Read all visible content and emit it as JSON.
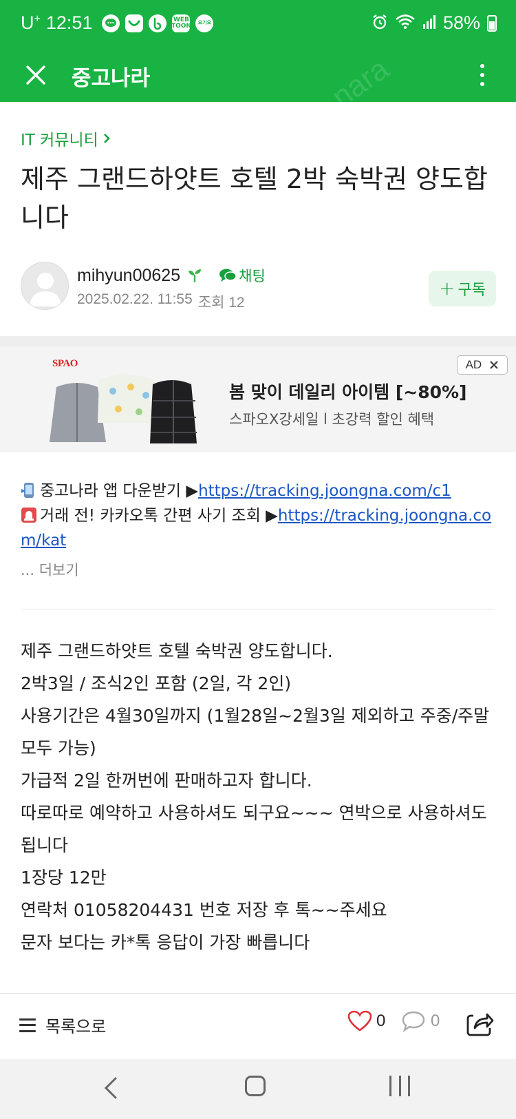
{
  "status_bar": {
    "carrier": "U",
    "carrier_sup": "+",
    "time": "12:51",
    "apps": [
      "chat-icon",
      "smile-app-icon",
      "b-app-icon",
      "webtoon-icon",
      "ohgiyo-icon"
    ],
    "webtoon_label": "WEB TOON",
    "ohgiyo_label": "요기요",
    "battery": "58%"
  },
  "app_bar": {
    "title": "중고나라",
    "watermark": "nara"
  },
  "article": {
    "breadcrumb": "IT 커뮤니티",
    "title": "제주 그랜드하얏트 호텔 2박 숙박권 양도합니다",
    "author": "mihyun00625",
    "chat_label": "채팅",
    "date": "2025.02.22. 11:55",
    "views": "조회 12",
    "subscribe_label": "구독"
  },
  "ad": {
    "brand": "SPAO",
    "badge": "AD",
    "title": "봄 맞이 데일리 아이템 [~80%]",
    "subtitle": "스파오X강세일 l 초강력 할인 혜택"
  },
  "links": {
    "line1_text": "중고나라 앱 다운받기 ▶",
    "line1_url": "https://tracking.joongna.com/c1",
    "line2_text": "거래 전! 카카오톡 간편 사기 조회 ▶",
    "line2_url": "https://tracking.joongna.com/kat",
    "more": "... 더보기"
  },
  "body_lines": [
    "제주 그랜드하얏트 호텔 숙박권 양도합니다.",
    "2박3일 / 조식2인 포함 (2일, 각 2인)",
    "사용기간은 4월30일까지 (1월28일~2월3일 제외하고 주중/주말 모두 가능)",
    "가급적 2일 한꺼번에 판매하고자 합니다.",
    "따로따로 예약하고 사용하셔도 되구요~~~ 연박으로 사용하셔도 됩니다",
    "1장당 12만",
    "연락처 01058204431 번호 저장 후 톡~~주세요",
    "문자 보다는 카*톡 응답이 가장 빠릅니다"
  ],
  "bottom_bar": {
    "list_label": "목록으로",
    "likes": "0",
    "comments": "0"
  },
  "colors": {
    "brand_green": "#18b343",
    "link_blue": "#1a56c5",
    "heart_red": "#e0303a"
  }
}
